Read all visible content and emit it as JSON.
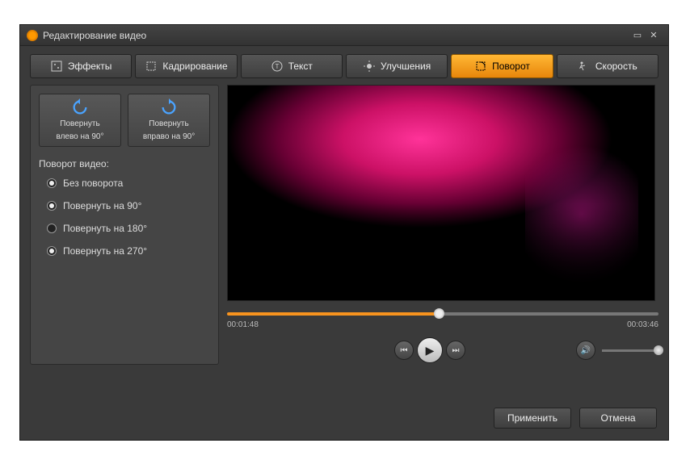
{
  "window": {
    "title": "Редактирование видео"
  },
  "tabs": {
    "effects": "Эффекты",
    "crop": "Кадрирование",
    "text": "Текст",
    "enhance": "Улучшения",
    "rotate": "Поворот",
    "speed": "Скорость",
    "active": "rotate"
  },
  "rotate": {
    "left_line1": "Повернуть",
    "left_line2": "влево  на 90°",
    "right_line1": "Повернуть",
    "right_line2": "вправо на 90°",
    "section_label": "Поворот видео:",
    "options": [
      {
        "label": "Без поворота",
        "selected": false
      },
      {
        "label": "Повернуть на 90°",
        "selected": false
      },
      {
        "label": "Повернуть на 180°",
        "selected": true
      },
      {
        "label": "Повернуть на 270°",
        "selected": false
      }
    ]
  },
  "player": {
    "current_time": "00:01:48",
    "total_time": "00:03:46",
    "progress_percent": 48
  },
  "footer": {
    "apply": "Применить",
    "cancel": "Отмена"
  }
}
